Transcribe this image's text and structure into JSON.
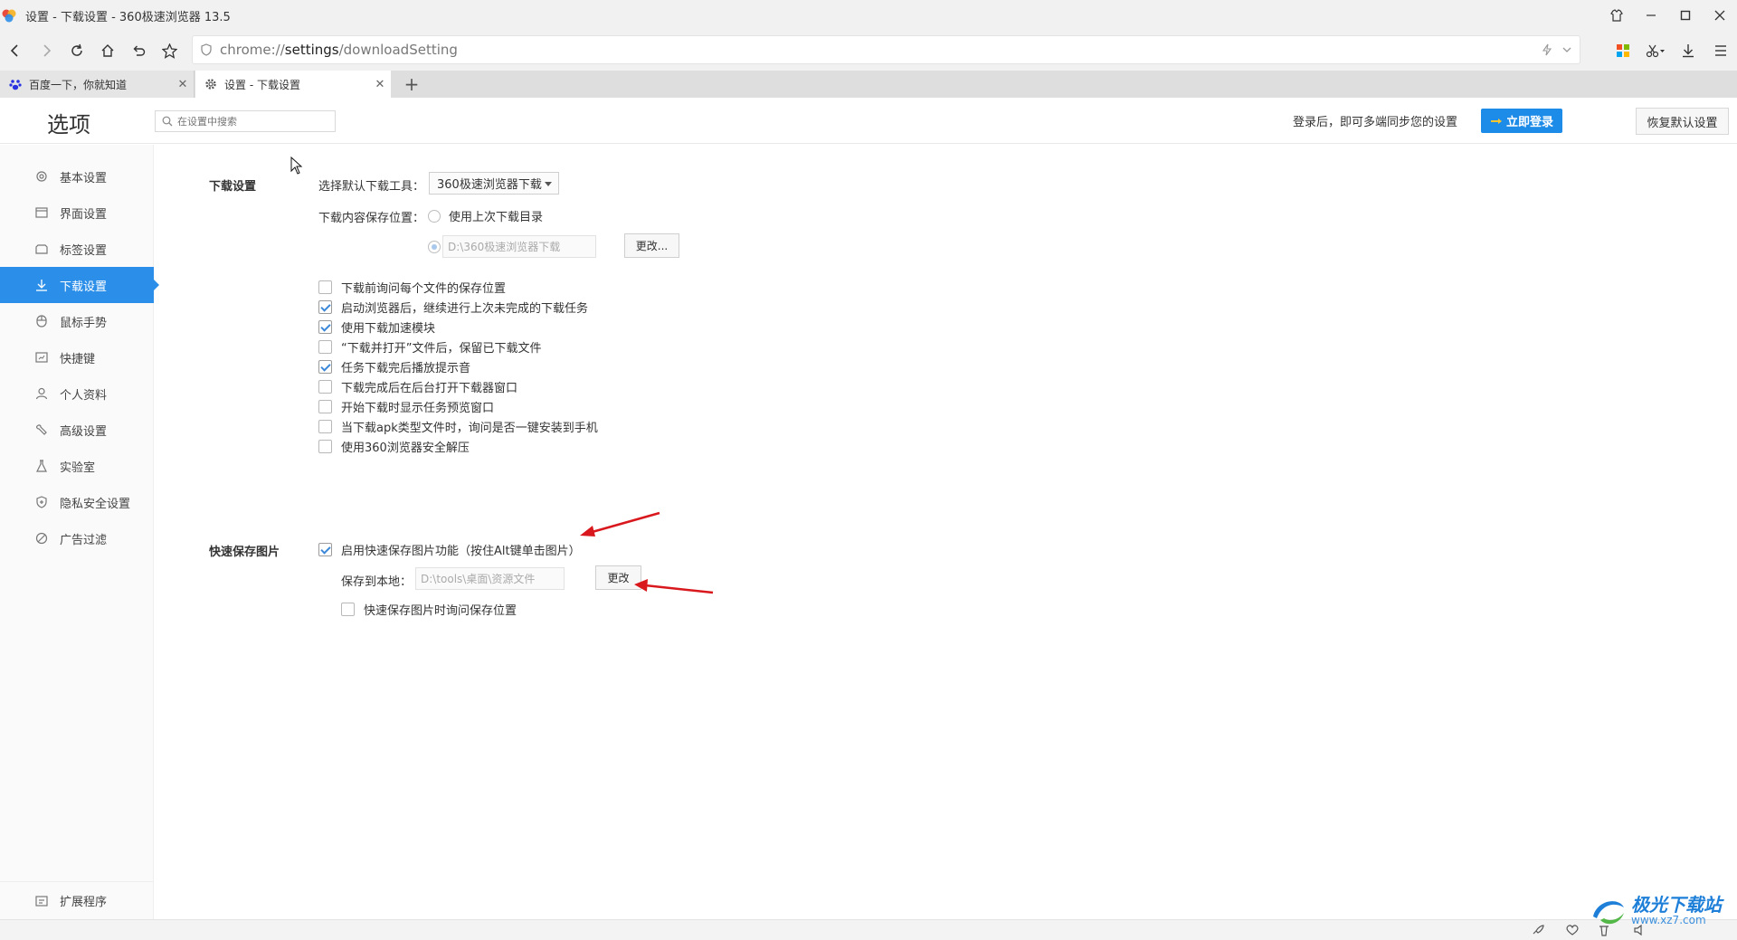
{
  "window": {
    "title": "设置 - 下载设置 - 360极速浏览器 13.5"
  },
  "toolbar": {
    "url_prefix": "chrome://",
    "url_main": "settings",
    "url_suffix": "/downloadSetting"
  },
  "tabs": [
    {
      "label": "百度一下，你就知道",
      "active": false
    },
    {
      "label": "设置 - 下载设置",
      "active": true
    }
  ],
  "header": {
    "title": "选项",
    "search_placeholder": "在设置中搜索",
    "login_hint": "登录后，即可多端同步您的设置",
    "login_button": "立即登录",
    "restore_button": "恢复默认设置"
  },
  "sidebar": {
    "items": [
      {
        "label": "基本设置",
        "icon": "gear-icon"
      },
      {
        "label": "界面设置",
        "icon": "window-icon"
      },
      {
        "label": "标签设置",
        "icon": "tab-icon"
      },
      {
        "label": "下载设置",
        "icon": "download-icon"
      },
      {
        "label": "鼠标手势",
        "icon": "mouse-icon"
      },
      {
        "label": "快捷键",
        "icon": "keyboard-icon"
      },
      {
        "label": "个人资料",
        "icon": "user-icon"
      },
      {
        "label": "高级设置",
        "icon": "wrench-icon"
      },
      {
        "label": "实验室",
        "icon": "flask-icon"
      },
      {
        "label": "隐私安全设置",
        "icon": "shield-icon"
      },
      {
        "label": "广告过滤",
        "icon": "block-icon"
      }
    ],
    "active_index": 3,
    "bottom_item": "扩展程序"
  },
  "download": {
    "section_title": "下载设置",
    "tool_label": "选择默认下载工具：",
    "tool_selected": "360极速浏览器下载",
    "location_label": "下载内容保存位置：",
    "radio_last": "使用上次下载目录",
    "custom_path": "D:\\360极速浏览器下载",
    "change_button": "更改...",
    "checkboxes": [
      {
        "label": "下载前询问每个文件的保存位置",
        "checked": false
      },
      {
        "label": "启动浏览器后，继续进行上次未完成的下载任务",
        "checked": true
      },
      {
        "label": "使用下载加速模块",
        "checked": true
      },
      {
        "label": "“下载并打开”文件后，保留已下载文件",
        "checked": false
      },
      {
        "label": "任务下载完后播放提示音",
        "checked": true
      },
      {
        "label": "下载完成后在后台打开下载器窗口",
        "checked": false
      },
      {
        "label": "开始下载时显示任务预览窗口",
        "checked": false
      },
      {
        "label": "当下载apk类型文件时，询问是否一键安装到手机",
        "checked": false
      },
      {
        "label": "使用360浏览器安全解压",
        "checked": false
      }
    ]
  },
  "quicksave": {
    "section_title": "快速保存图片",
    "enable_label": "启用快速保存图片功能（按住Alt键单击图片）",
    "enable_checked": true,
    "save_to_label": "保存到本地：",
    "save_path": "D:\\tools\\桌面\\资源文件",
    "change_button": "更改",
    "ask_label": "快速保存图片时询问保存位置",
    "ask_checked": false
  },
  "watermark": {
    "line1": "极光下载站",
    "line2": "www.xz7.com"
  },
  "colors": {
    "accent": "#2b8fea",
    "login_button": "#1d8be8",
    "arrow": "#d9181e"
  }
}
